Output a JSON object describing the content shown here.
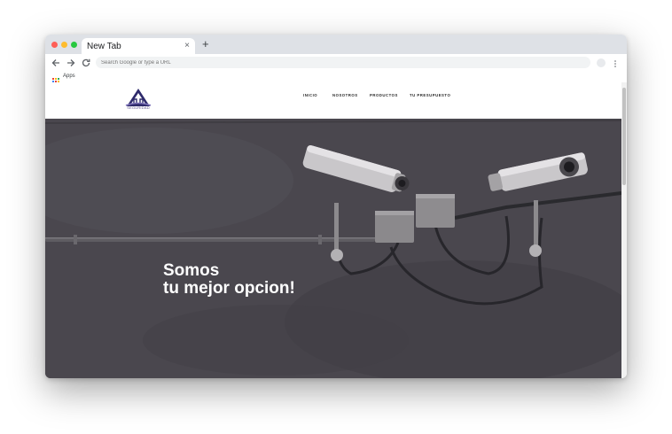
{
  "browser": {
    "tab_title": "New Tab",
    "tab_close_glyph": "×",
    "new_tab_glyph": "+",
    "omnibox_placeholder": "Search Google or type a URL",
    "bookmarks": {
      "apps_label": "Apps"
    },
    "icons": [
      "back-arrow-icon",
      "forward-arrow-icon",
      "reload-icon",
      "profile-icon",
      "menu-dots-icon",
      "apps-grid-icon"
    ]
  },
  "site": {
    "logo_text": "SEGURIDAD",
    "nav": [
      "INICIO",
      "NOSOTROS",
      "PRODUCTOS",
      "TU PRESUPUESTO"
    ],
    "hero": {
      "line1": "Somos",
      "line2": "tu mejor opcion!"
    }
  },
  "colors": {
    "tabbar": "#dee1e6",
    "hero_wall": "#47444b",
    "logo_purple": "#5a4f8c",
    "hero_text": "#ffffff"
  }
}
